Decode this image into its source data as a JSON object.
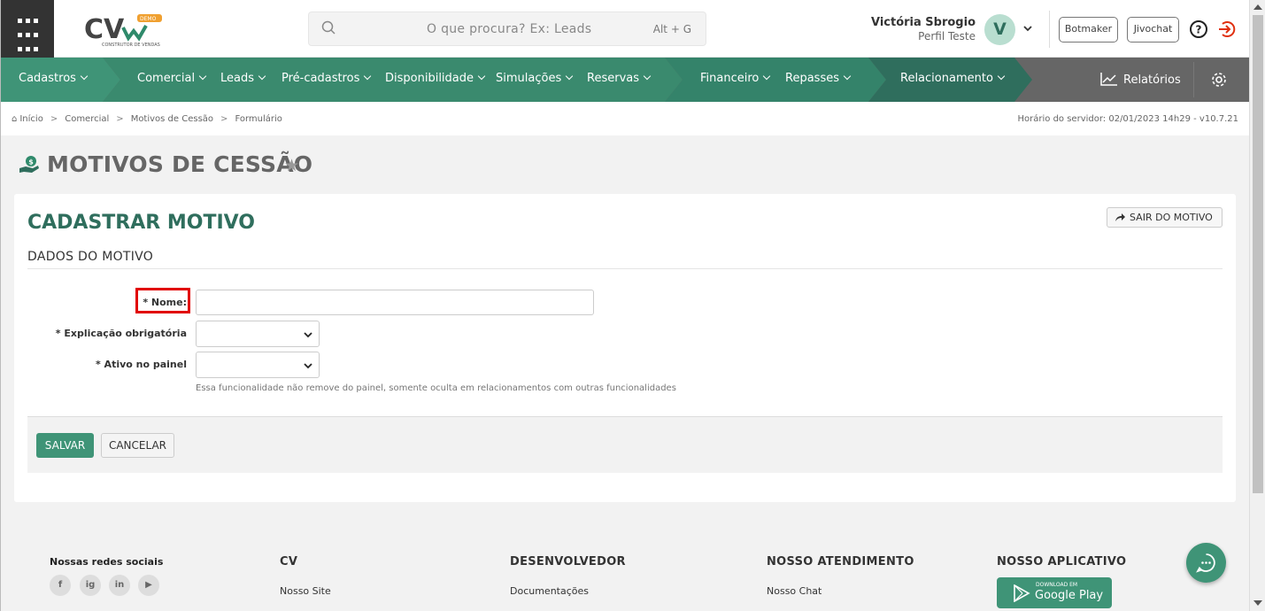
{
  "header": {
    "logo_text": "CV",
    "logo_tag": "DEMO",
    "logo_sub": "CONSTRUTOR DE VENDAS",
    "search_placeholder": "O que procura? Ex: Leads",
    "search_shortcut": "Alt + G",
    "user_name": "Victória Sbrogio",
    "user_profile": "Perfil Teste",
    "avatar_letter": "V",
    "botmaker": "Botmaker",
    "jivochat": "Jivochat"
  },
  "nav": {
    "items": [
      "Cadastros",
      "Comercial",
      "Leads",
      "Pré-cadastros",
      "Disponibilidade",
      "Simulações",
      "Reservas",
      "Financeiro",
      "Repasses",
      "Relacionamento"
    ],
    "reports": "Relatórios"
  },
  "breadcrumb": {
    "items": [
      "Início",
      "Comercial",
      "Motivos de Cessão",
      "Formulário"
    ],
    "server_time": "Horário do servidor: 02/01/2023 14h29 - v10.7.21"
  },
  "page": {
    "title": "MOTIVOS DE CESSÃO"
  },
  "form": {
    "heading": "CADASTRAR MOTIVO",
    "exit_button": "SAIR DO MOTIVO",
    "section": "DADOS DO MOTIVO",
    "name_label": "* Nome:",
    "name_value": "",
    "explanation_label": "* Explicação obrigatória",
    "explanation_value": "",
    "active_label": "* Ativo no painel",
    "active_value": "",
    "active_help": "Essa funcionalidade não remove do painel, somente oculta em relacionamentos com outras funcionalidades",
    "save": "SALVAR",
    "cancel": "CANCELAR"
  },
  "footer": {
    "social_title": "Nossas redes sociais",
    "social_icons": [
      "f",
      "ig",
      "in",
      "▶"
    ],
    "cv_title": "CV",
    "cv_link": "Nosso Site",
    "dev_title": "DESENVOLVEDOR",
    "dev_link": "Documentações",
    "support_title": "NOSSO ATENDIMENTO",
    "support_link": "Nosso Chat",
    "app_title": "NOSSO APLICATIVO",
    "gplay_small": "DOWNLOAD EM",
    "gplay_big": "Google Play"
  },
  "colors": {
    "brand": "#3f9477",
    "title_green": "#2f6e5d",
    "highlight": "#e10000"
  }
}
